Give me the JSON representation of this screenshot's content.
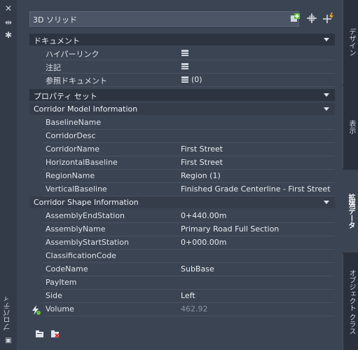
{
  "left_toolbar": {
    "vertical_title": "プロパティ"
  },
  "object_selector": {
    "value": "3D ソリッド"
  },
  "sections": {
    "document": {
      "title": "ドキュメント"
    },
    "property_sets": {
      "title": "プロパティ セット"
    },
    "corridor_model": {
      "title": "Corridor Model Information"
    },
    "corridor_shape": {
      "title": "Corridor Shape Information"
    }
  },
  "document_rows": [
    {
      "name": "ハイパーリンク",
      "value": ""
    },
    {
      "name": "注記",
      "value": ""
    },
    {
      "name": "参照ドキュメント",
      "value": "(0)"
    }
  ],
  "corridor_model_rows": [
    {
      "name": "BaselineName",
      "value": ""
    },
    {
      "name": "CorridorDesc",
      "value": ""
    },
    {
      "name": "CorridorName",
      "value": "First Street"
    },
    {
      "name": "HorizontalBaseline",
      "value": "First Street"
    },
    {
      "name": "RegionName",
      "value": "Region (1)"
    },
    {
      "name": "VerticalBaseline",
      "value": "Finished Grade Centerline - First Street"
    }
  ],
  "corridor_shape_rows": [
    {
      "name": "AssemblyEndStation",
      "value": "0+440.00m"
    },
    {
      "name": "AssemblyName",
      "value": "Primary Road Full Section"
    },
    {
      "name": "AssemblyStartStation",
      "value": "0+000.00m"
    },
    {
      "name": "ClassificationCode",
      "value": ""
    },
    {
      "name": "CodeName",
      "value": "SubBase"
    },
    {
      "name": "PayItem",
      "value": ""
    },
    {
      "name": "Side",
      "value": "Left"
    },
    {
      "name": "Volume",
      "value": "462.92"
    }
  ],
  "right_tabs": [
    {
      "label": "デザイン"
    },
    {
      "label": "表示"
    },
    {
      "label": "拡張データ"
    },
    {
      "label": "オブジェクト クラス"
    }
  ],
  "active_tab": "拡張データ",
  "colors": {
    "panel_bg": "#3b4453",
    "header_bg": "#2d3440",
    "text": "#dfe3ea",
    "accent_green": "#5fbf3a",
    "accent_orange": "#f0a020"
  }
}
